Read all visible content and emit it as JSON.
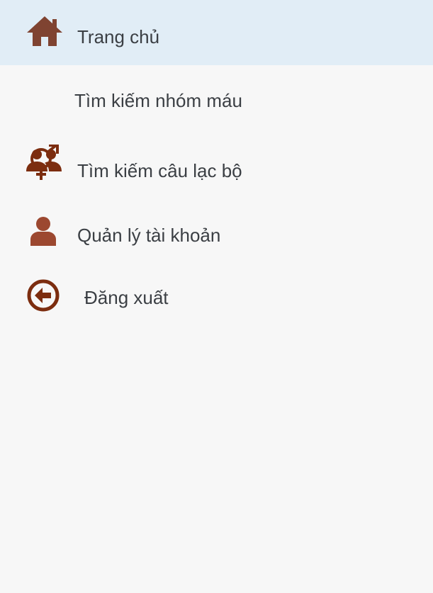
{
  "colors": {
    "active_background": "#e1edf6",
    "background": "#f7f7f7",
    "icon_home": "#7f4331",
    "icon_primary": "#7c2d0f",
    "icon_person": "#9c4830",
    "text": "#3b3f44"
  },
  "menu": {
    "items": [
      {
        "label": "Trang chủ",
        "icon": "home-icon",
        "active": true
      },
      {
        "label": "Tìm kiếm nhóm máu",
        "icon": "gender-icon",
        "active": false
      },
      {
        "label": "Tìm kiếm câu lạc bộ",
        "icon": "group-icon",
        "active": false
      },
      {
        "label": "Quản lý tài khoản",
        "icon": "person-icon",
        "active": false
      },
      {
        "label": "Đăng xuất",
        "icon": "logout-icon",
        "active": false
      }
    ]
  }
}
